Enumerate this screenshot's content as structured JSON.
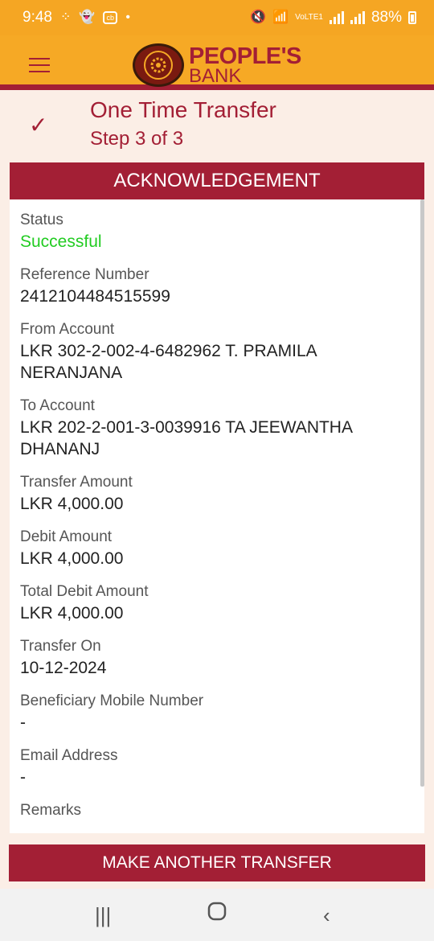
{
  "status_bar": {
    "time": "9:48",
    "battery": "88%",
    "network": "VoLTE1"
  },
  "header": {
    "brand_line1": "PEOPLE'S",
    "brand_line2": "BANK",
    "menu_icon": "hamburger-icon",
    "logo_icon": "bank-seal-icon"
  },
  "step": {
    "title": "One Time Transfer",
    "subtitle": "Step 3 of 3",
    "icon": "check-icon"
  },
  "card": {
    "heading": "ACKNOWLEDGEMENT",
    "fields": [
      {
        "label": "Status",
        "value": "Successful"
      },
      {
        "label": "Reference Number",
        "value": "2412104484515599"
      },
      {
        "label": "From Account",
        "value": "LKR 302-2-002-4-6482962 T. PRAMILA NERANJANA"
      },
      {
        "label": "To Account",
        "value": "LKR 202-2-001-3-0039916 TA JEEWANTHA DHANANJ"
      },
      {
        "label": "Transfer Amount",
        "value": "LKR 4,000.00"
      },
      {
        "label": "Debit Amount",
        "value": "LKR 4,000.00"
      },
      {
        "label": "Total Debit Amount",
        "value": "LKR 4,000.00"
      },
      {
        "label": "Transfer On",
        "value": "10-12-2024"
      },
      {
        "label": "Beneficiary Mobile Number",
        "value": "-"
      },
      {
        "label": "Email Address",
        "value": "-"
      },
      {
        "label": "Remarks",
        "value": ""
      }
    ]
  },
  "actions": {
    "make_another_transfer": "MAKE ANOTHER TRANSFER"
  },
  "colors": {
    "brand_red": "#a31f35",
    "brand_orange": "#f6a925",
    "success_green": "#22cc22"
  },
  "nav": {
    "recent_icon": "recent-apps-icon",
    "home_icon": "home-icon",
    "back_icon": "back-icon"
  }
}
